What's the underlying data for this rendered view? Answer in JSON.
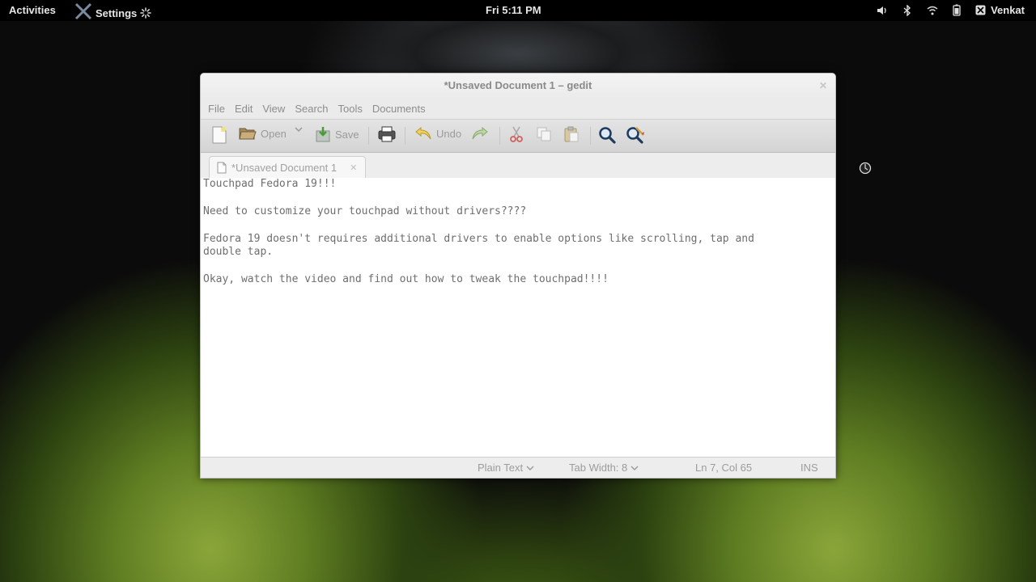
{
  "topbar": {
    "activities": "Activities",
    "app_name": "Settings",
    "clock": "Fri  5:11 PM",
    "user": "Venkat"
  },
  "window": {
    "title": "*Unsaved Document 1 – gedit",
    "menu": [
      "File",
      "Edit",
      "View",
      "Search",
      "Tools",
      "Documents"
    ],
    "toolbar": {
      "open_label": "Open",
      "save_label": "Save",
      "undo_label": "Undo"
    },
    "tab": {
      "label": "*Unsaved Document 1"
    },
    "editor_lines": [
      "Touchpad Fedora 19!!!",
      "",
      "Need to customize your touchpad without drivers????",
      "",
      "Fedora 19 doesn't requires additional drivers to enable options like scrolling, tap and",
      "double tap.",
      "",
      "Okay, watch the video and find out how to tweak the touchpad!!!!"
    ],
    "status": {
      "language": "Plain Text",
      "tab_width": "Tab Width:  8",
      "position": "Ln 7, Col 65",
      "mode": "INS"
    }
  },
  "colors": {
    "topbar_bg": "#000000",
    "window_bg": "#ededed",
    "disabled_text": "#9a9a9a"
  }
}
